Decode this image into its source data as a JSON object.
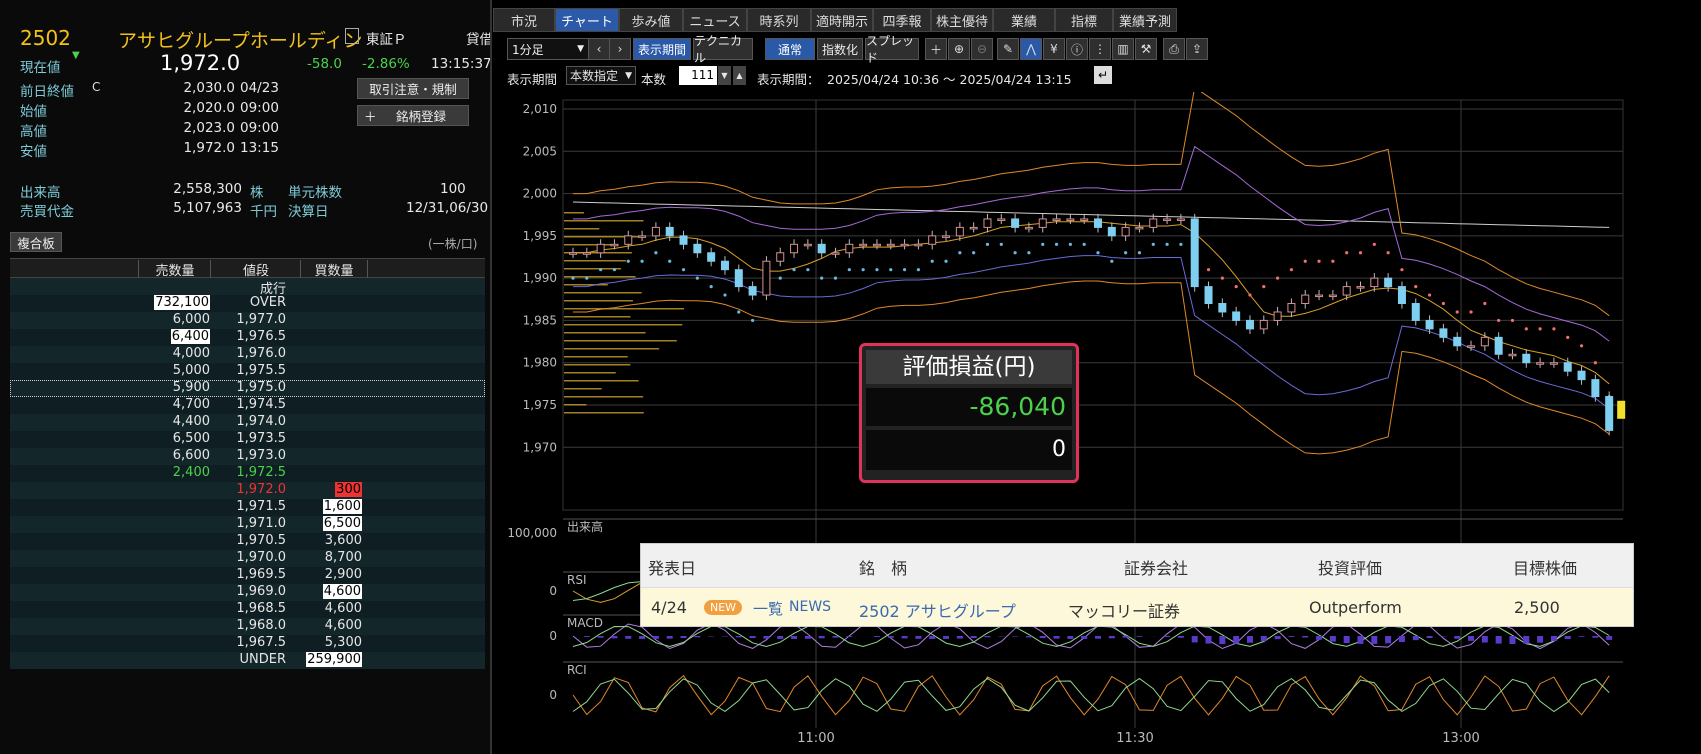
{
  "stock": {
    "code": "2502",
    "name": "アサヒグループホールディン",
    "exchange": "東証Ｐ",
    "exchange_extra": "貸借",
    "current_label": "現在値",
    "price": "1,972.0",
    "change": "-58.0",
    "change_pct": "-2.86%",
    "time": "13:15:37"
  },
  "quote": [
    {
      "label": "前日終値",
      "mark": "C",
      "value": "2,030.0",
      "time": "04/23"
    },
    {
      "label": "始値",
      "mark": "",
      "value": "2,020.0",
      "time": "09:00"
    },
    {
      "label": "高値",
      "mark": "",
      "value": "2,023.0",
      "time": "09:00"
    },
    {
      "label": "安値",
      "mark": "",
      "value": "1,972.0",
      "time": "13:15"
    }
  ],
  "volume": {
    "label": "出来高",
    "value": "2,558,300",
    "unit": "株"
  },
  "turnover": {
    "label": "売買代金",
    "value": "5,107,963",
    "unit": "千円"
  },
  "unit_shares": {
    "label": "単元株数",
    "value": "100"
  },
  "settlement": {
    "label": "決算日",
    "value": "12/31,06/30"
  },
  "buttons": {
    "order_rules": "取引注意・規制",
    "register": "銘柄登録"
  },
  "board": {
    "title": "複合板",
    "unit_note": "(一株/口)",
    "headers": [
      "売数量",
      "値段",
      "買数量"
    ],
    "rows": [
      {
        "sell": "",
        "price": "成行",
        "buy": ""
      },
      {
        "sell": "732,100",
        "price": "OVER",
        "buy": ""
      },
      {
        "sell": "6,000",
        "price": "1,977.0",
        "buy": ""
      },
      {
        "sell": "6,400",
        "price": "1,976.5",
        "buy": ""
      },
      {
        "sell": "4,000",
        "price": "1,976.0",
        "buy": ""
      },
      {
        "sell": "5,000",
        "price": "1,975.5",
        "buy": ""
      },
      {
        "sell": "5,900",
        "price": "1,975.0",
        "buy": ""
      },
      {
        "sell": "4,700",
        "price": "1,974.5",
        "buy": ""
      },
      {
        "sell": "4,400",
        "price": "1,974.0",
        "buy": ""
      },
      {
        "sell": "6,500",
        "price": "1,973.5",
        "buy": ""
      },
      {
        "sell": "6,600",
        "price": "1,973.0",
        "buy": ""
      },
      {
        "sell": "2,400",
        "price": "1,972.5",
        "buy": ""
      },
      {
        "sell": "",
        "price": "1,972.0",
        "buy": "300"
      },
      {
        "sell": "",
        "price": "1,971.5",
        "buy": "1,600"
      },
      {
        "sell": "",
        "price": "1,971.0",
        "buy": "6,500"
      },
      {
        "sell": "",
        "price": "1,970.5",
        "buy": "3,600"
      },
      {
        "sell": "",
        "price": "1,970.0",
        "buy": "8,700"
      },
      {
        "sell": "",
        "price": "1,969.5",
        "buy": "2,900"
      },
      {
        "sell": "",
        "price": "1,969.0",
        "buy": "4,600"
      },
      {
        "sell": "",
        "price": "1,968.5",
        "buy": "4,600"
      },
      {
        "sell": "",
        "price": "1,968.0",
        "buy": "4,600"
      },
      {
        "sell": "",
        "price": "1,967.5",
        "buy": "5,300"
      },
      {
        "sell": "",
        "price": "UNDER",
        "buy": "259,900"
      }
    ]
  },
  "tabs": [
    "市況",
    "チャート",
    "歩み値",
    "ニュース",
    "時系列",
    "適時開示",
    "四季報",
    "株主優待",
    "業績",
    "指標",
    "業績予測"
  ],
  "toolbar": {
    "interval": "1分足",
    "period_btn": "表示期間",
    "technical_btn": "テクニカル",
    "normal_btn": "通常",
    "index_btn": "指数化",
    "spread_btn": "スプレッド"
  },
  "period_bar": {
    "label": "表示期間",
    "mode": "本数指定",
    "count_label": "本数",
    "count": "111",
    "range_label": "表示期間：",
    "range": "2025/04/24 10:36 ～ 2025/04/24 13:15"
  },
  "chart": {
    "y_ticks": [
      "2,010",
      "2,005",
      "2,000",
      "1,995",
      "1,990",
      "1,985",
      "1,980",
      "1,975",
      "1,970"
    ],
    "x_ticks": [
      "11:00",
      "11:30",
      "13:00"
    ],
    "volume_top": "100,000",
    "panels": [
      "出来高",
      "RSI",
      "MACD",
      "RCI"
    ],
    "panel_zero": "0"
  },
  "chart_data": {
    "type": "line",
    "y_ticks": [
      2010,
      2005,
      2000,
      1995,
      1990,
      1985,
      1980,
      1975,
      1970
    ],
    "x_ticks": [
      "11:00",
      "11:30",
      "13:00"
    ],
    "close": [
      1993,
      1993,
      1994,
      1994,
      1995,
      1995,
      1996,
      1995,
      1994,
      1993,
      1992,
      1991,
      1989,
      1988,
      1992,
      1993,
      1994,
      1994,
      1993,
      1993,
      1994,
      1994,
      1994,
      1994,
      1994,
      1994,
      1995,
      1995,
      1996,
      1996,
      1997,
      1997,
      1996,
      1996,
      1997,
      1997,
      1997,
      1997,
      1996,
      1995,
      1996,
      1996,
      1997,
      1997,
      1997,
      1989,
      1987,
      1986,
      1985,
      1984,
      1985,
      1986,
      1987,
      1988,
      1988,
      1988,
      1989,
      1989,
      1990,
      1989,
      1987,
      1985,
      1984,
      1983,
      1982,
      1982,
      1983,
      1981,
      1981,
      1980,
      1980,
      1980,
      1979,
      1978,
      1976,
      1972
    ],
    "x_range": [
      "10:36",
      "13:15"
    ]
  },
  "pnl": {
    "title": "評価損益(円)",
    "value": "-86,040",
    "sub": "0"
  },
  "news": {
    "headers": [
      "発表日",
      "銘　柄",
      "証券会社",
      "投資評価",
      "目標株価"
    ],
    "date": "4/24",
    "badge": "NEW",
    "list_link": "一覧",
    "news_link": "NEWS",
    "stock": "2502 アサヒグループ",
    "broker": "マッコリー証券",
    "rating": "Outperform",
    "target": "2,500"
  }
}
